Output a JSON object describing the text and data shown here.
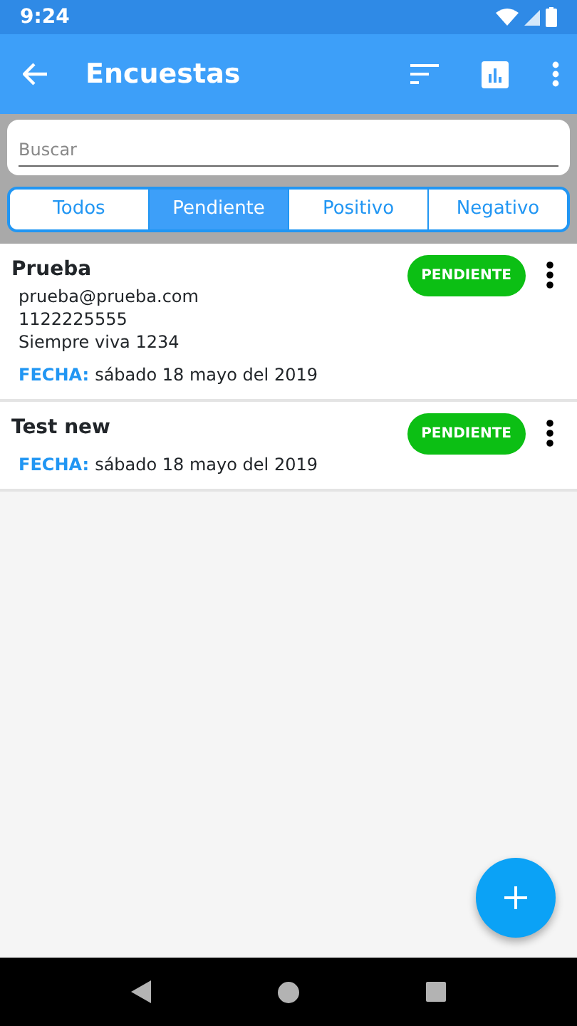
{
  "status_bar": {
    "time": "9:24"
  },
  "app_bar": {
    "title": "Encuestas"
  },
  "search": {
    "placeholder": "Buscar"
  },
  "filters": [
    {
      "label": "Todos",
      "selected": false
    },
    {
      "label": "Pendiente",
      "selected": true
    },
    {
      "label": "Positivo",
      "selected": false
    },
    {
      "label": "Negativo",
      "selected": false
    }
  ],
  "surveys": [
    {
      "name": "Prueba",
      "status": "PENDIENTE",
      "details": [
        "prueba@prueba.com",
        "1122225555",
        "Siempre viva 1234"
      ],
      "date_label": "FECHA:",
      "date": "sábado 18 mayo del 2019"
    },
    {
      "name": "Test new",
      "status": "PENDIENTE",
      "date_label": "FECHA:",
      "date": "sábado 18 mayo del 2019"
    }
  ]
}
